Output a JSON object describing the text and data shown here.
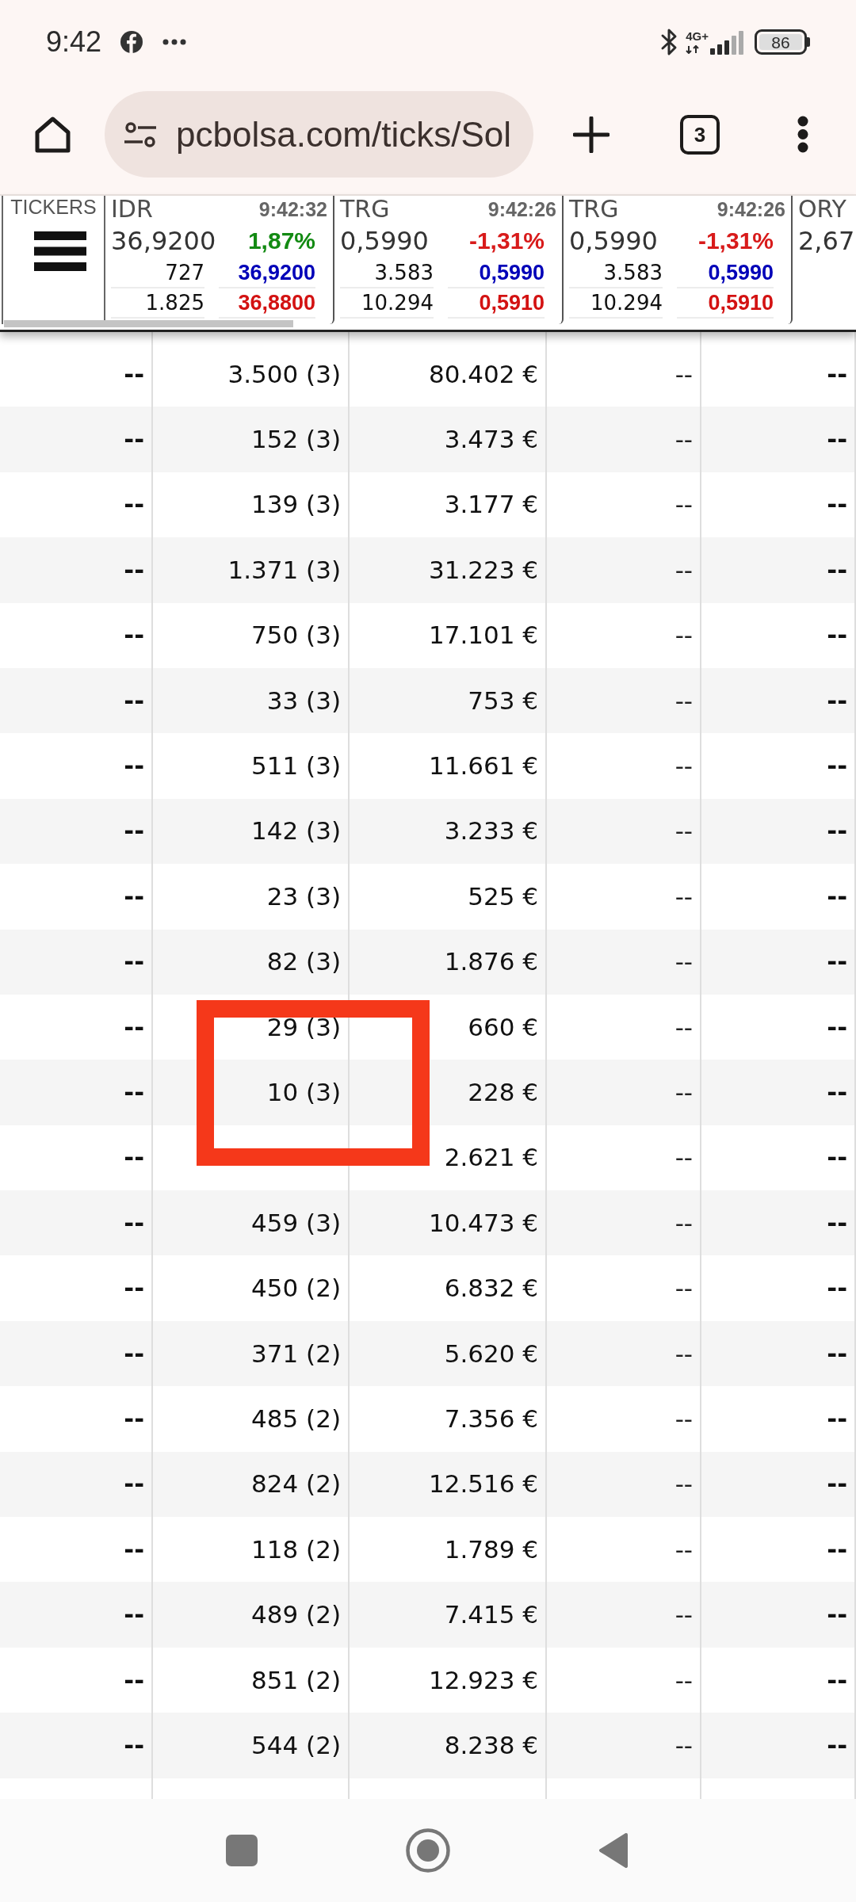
{
  "status_bar": {
    "time": "9:42",
    "network": "4G+",
    "battery": "86"
  },
  "browser_bar": {
    "url": "pcbolsa.com/ticks/Sol",
    "tab_count": "3"
  },
  "ticker_strip": {
    "label": "TICKERS",
    "tickers": [
      {
        "symbol": "IDR",
        "time": "9:42:32",
        "price": "36,9200",
        "change": "1,87%",
        "color": "#138a13",
        "row_3": [
          "727",
          "36,9200"
        ],
        "row_4": [
          "1.825",
          "36,8800"
        ]
      },
      {
        "symbol": "TRG",
        "time": "9:42:26",
        "price": "0,5990",
        "change": "-1,31%",
        "color": "#d81b1b",
        "row_3": [
          "3.583",
          "0,5990"
        ],
        "row_4": [
          "10.294",
          "0,5910"
        ]
      },
      {
        "symbol": "TRG",
        "time": "9:42:26",
        "price": "0,5990",
        "change": "-1,31%",
        "color": "#d81b1b",
        "row_3": [
          "3.583",
          "0,5990"
        ],
        "row_4": [
          "10.294",
          "0,5910"
        ]
      },
      {
        "symbol": "ORY",
        "price": "2,67"
      }
    ]
  },
  "table": {
    "rows": [
      {
        "cells": [
          "--",
          "3.500 (3)",
          "80.402 €",
          "--",
          "--"
        ],
        "highlighted": false
      },
      {
        "cells": [
          "--",
          "152 (3)",
          "3.473 €",
          "--",
          "--"
        ],
        "highlighted": false
      },
      {
        "cells": [
          "--",
          "139 (3)",
          "3.177 €",
          "--",
          "--"
        ],
        "highlighted": false
      },
      {
        "cells": [
          "--",
          "1.371 (3)",
          "31.223 €",
          "--",
          "--"
        ],
        "highlighted": false
      },
      {
        "cells": [
          "--",
          "750 (3)",
          "17.101 €",
          "--",
          "--"
        ],
        "highlighted": false
      },
      {
        "cells": [
          "--",
          "33 (3)",
          "753 €",
          "--",
          "--"
        ],
        "highlighted": false
      },
      {
        "cells": [
          "--",
          "511 (3)",
          "11.661 €",
          "--",
          "--"
        ],
        "highlighted": false
      },
      {
        "cells": [
          "--",
          "142 (3)",
          "3.233 €",
          "--",
          "--"
        ],
        "highlighted": false
      },
      {
        "cells": [
          "--",
          "23 (3)",
          "525 €",
          "--",
          "--"
        ],
        "highlighted": false
      },
      {
        "cells": [
          "--",
          "82 (3)",
          "1.876 €",
          "--",
          "--"
        ],
        "highlighted": false
      },
      {
        "cells": [
          "--",
          "29 (3)",
          "660 €",
          "--",
          "--"
        ],
        "highlighted": false
      },
      {
        "cells": [
          "--",
          "10 (3)",
          "228 €",
          "--",
          "--"
        ],
        "highlighted": true
      },
      {
        "cells": [
          "--",
          null,
          "2.621 €",
          "--",
          "--"
        ],
        "highlighted": false
      },
      {
        "cells": [
          "--",
          "459 (3)",
          "10.473 €",
          "--",
          "--"
        ],
        "highlighted": false
      },
      {
        "cells": [
          "--",
          "450 (2)",
          "6.832 €",
          "--",
          "--"
        ],
        "highlighted": false
      },
      {
        "cells": [
          "--",
          "371 (2)",
          "5.620 €",
          "--",
          "--"
        ],
        "highlighted": false
      },
      {
        "cells": [
          "--",
          "485 (2)",
          "7.356 €",
          "--",
          "--"
        ],
        "highlighted": false
      },
      {
        "cells": [
          "--",
          "824 (2)",
          "12.516 €",
          "--",
          "--"
        ],
        "highlighted": false
      },
      {
        "cells": [
          "--",
          "118 (2)",
          "1.789 €",
          "--",
          "--"
        ],
        "highlighted": false
      },
      {
        "cells": [
          "--",
          "489 (2)",
          "7.415 €",
          "--",
          "--"
        ],
        "highlighted": false
      },
      {
        "cells": [
          "--",
          "851 (2)",
          "12.923 €",
          "--",
          "--"
        ],
        "highlighted": false
      },
      {
        "cells": [
          "--",
          "544 (2)",
          "8.238 €",
          "--",
          "--"
        ],
        "highlighted": false
      }
    ]
  }
}
